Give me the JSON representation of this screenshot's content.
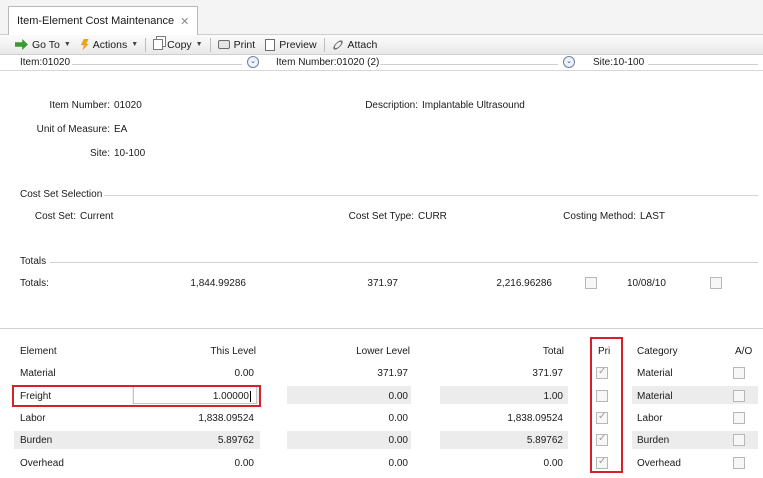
{
  "tab": {
    "title": "Item-Element Cost Maintenance",
    "close": "✕"
  },
  "toolbar": {
    "goto": "Go To",
    "actions": "Actions",
    "copy": "Copy",
    "print": "Print",
    "preview": "Preview",
    "attach": "Attach",
    "dropdown_glyph": "▼"
  },
  "selectors": {
    "item": "Item:01020",
    "item_number": "Item Number:01020 (2)",
    "site": "Site:10-100",
    "chevron": "⌄"
  },
  "header": {
    "item_number_label": "Item Number:",
    "item_number_value": "01020",
    "description_label": "Description:",
    "description_value": "Implantable Ultrasound",
    "uom_label": "Unit of Measure:",
    "uom_value": "EA",
    "site_label": "Site:",
    "site_value": "10-100"
  },
  "cost_set": {
    "section_title": "Cost Set Selection",
    "cost_set_label": "Cost Set:",
    "cost_set_value": "Current",
    "cost_set_type_label": "Cost Set Type:",
    "cost_set_type_value": "CURR",
    "costing_method_label": "Costing Method:",
    "costing_method_value": "LAST"
  },
  "totals": {
    "section_title": "Totals",
    "row_label": "Totals:",
    "this_level": "1,844.99286",
    "lower_level": "371.97",
    "total": "2,216.96286",
    "date": "10/08/10",
    "pri_checked": false,
    "ao_checked": false
  },
  "grid": {
    "columns": {
      "element": "Element",
      "this_level": "This Level",
      "lower_level": "Lower Level",
      "total": "Total",
      "pri": "Pri",
      "category": "Category",
      "ao": "A/O"
    },
    "rows": [
      {
        "element": "Material",
        "this_level": "0.00",
        "lower_level": "371.97",
        "total": "371.97",
        "pri": true,
        "category": "Material",
        "ao": false
      },
      {
        "element": "Freight",
        "this_level": "1.00000",
        "lower_level": "0.00",
        "total": "1.00",
        "pri": false,
        "category": "Material",
        "ao": false
      },
      {
        "element": "Labor",
        "this_level": "1,838.09524",
        "lower_level": "0.00",
        "total": "1,838.09524",
        "pri": true,
        "category": "Labor",
        "ao": false
      },
      {
        "element": "Burden",
        "this_level": "5.89762",
        "lower_level": "0.00",
        "total": "5.89762",
        "pri": true,
        "category": "Burden",
        "ao": false
      },
      {
        "element": "Overhead",
        "this_level": "0.00",
        "lower_level": "0.00",
        "total": "0.00",
        "pri": true,
        "category": "Overhead",
        "ao": false
      }
    ]
  },
  "colors": {
    "highlight_border": "#d3222a",
    "band": "#ececec"
  }
}
